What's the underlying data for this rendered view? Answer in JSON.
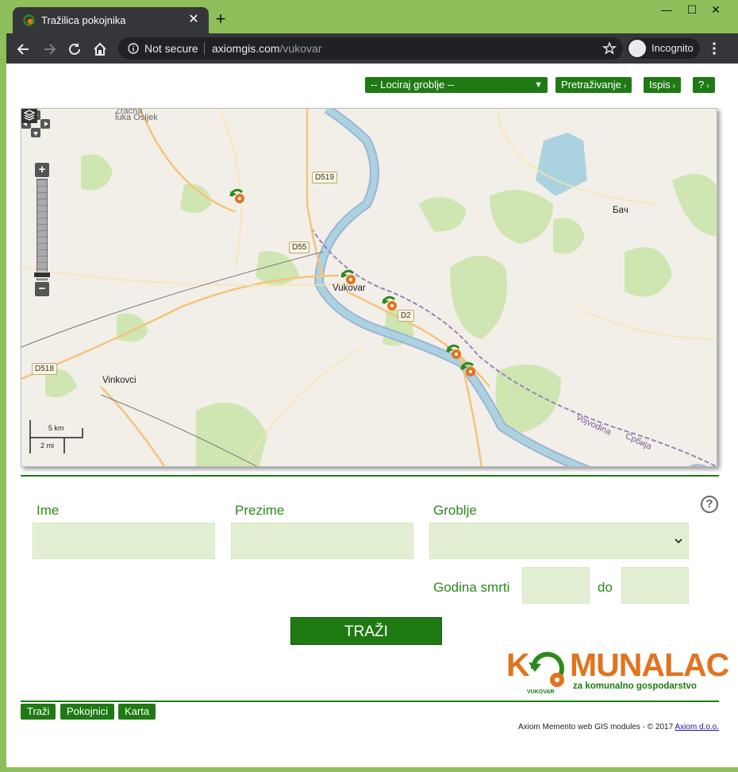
{
  "browser": {
    "tab_title": "Tražilica pokojnika",
    "security_label": "Not secure",
    "url_host": "axiomgis.com",
    "url_path": "/vukovar",
    "incognito_label": "Incognito"
  },
  "topbar": {
    "locate_cemetery": "-- Lociraj groblje --",
    "search_link": "Pretraživanje",
    "print_link": "Ispis",
    "help_link": "?"
  },
  "map": {
    "labels": {
      "zracna_line1": "Zračna",
      "zracna_line2": "luka Osijek",
      "vukovar": "Vukovar",
      "vinkovci": "Vinkovci",
      "bac": "Бач",
      "vojvodina": "Vojvodina",
      "srbija": "Србија"
    },
    "roads": {
      "d519": "D519",
      "d55": "D55",
      "d2": "D2",
      "d518": "D518"
    },
    "scale_km": "5 km",
    "scale_mi": "2 mi"
  },
  "form": {
    "ime_label": "Ime",
    "prezime_label": "Prezime",
    "groblje_label": "Groblje",
    "godina_label": "Godina smrti",
    "do_label": "do",
    "help": "?",
    "search_button": "TRAŽI"
  },
  "logo": {
    "word_left": "K",
    "word_right": "MUNALAC",
    "tagline": "za komunalno gospodarstvo",
    "small": "VUKOVAR"
  },
  "bottom_tabs": {
    "trazi": "Traži",
    "pokojnici": "Pokojnici",
    "karta": "Karta"
  },
  "footer": {
    "text": "Axiom Memento web GIS modules - © 2017",
    "link": "Axiom d.o.o."
  },
  "colors": {
    "brand_green": "#1f7a14",
    "label_green": "#2c8a1c",
    "field_bg": "#e3efd3",
    "logo_orange": "#e2731f",
    "window_frame": "#8fbf5a"
  }
}
